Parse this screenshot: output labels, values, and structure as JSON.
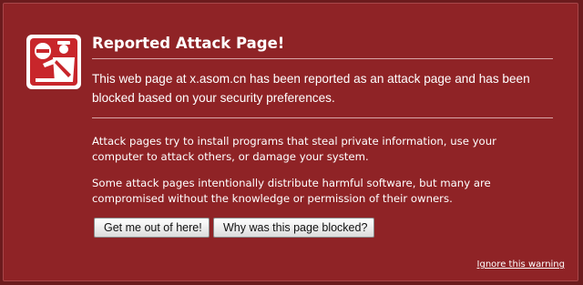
{
  "colors": {
    "page_background": "#6b1b1d",
    "panel_background": "#8f2326",
    "text": "#ffffff"
  },
  "icon": "shield-icon",
  "warning": {
    "title": "Reported Attack Page!",
    "lead": "This web page at x.asom.cn has been reported as an attack page and has been blocked based on your security preferences.",
    "para1": "Attack pages try to install programs that steal private information, use your computer to attack others, or damage your system.",
    "para2": "Some attack pages intentionally distribute harmful software, but many are compromised without the knowledge or permission of their owners.",
    "get_out_button": "Get me out of here!",
    "why_blocked_button": "Why was this page blocked?",
    "ignore_link": "Ignore this warning"
  }
}
